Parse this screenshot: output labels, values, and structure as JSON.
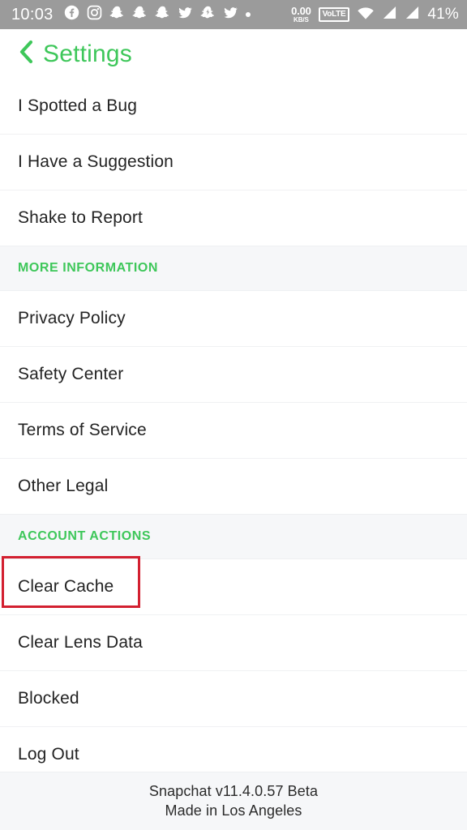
{
  "status_bar": {
    "time": "10:03",
    "background_color": "#9b9b9b",
    "left_icons": [
      "facebook-icon",
      "instagram-icon",
      "snapchat-icon",
      "snapchat-icon",
      "snapchat-icon",
      "twitter-icon",
      "snapchat-bolt-icon",
      "twitter-icon",
      "dot-indicator-icon"
    ],
    "data_rate_value": "0.00",
    "data_rate_unit": "KB/S",
    "volte_badge": "VoLTE",
    "right_icons": [
      "wifi-icon",
      "signal-icon",
      "signal-icon"
    ],
    "battery": "41%"
  },
  "header": {
    "back_icon": "chevron-left-icon",
    "title": "Settings",
    "accent_color": "#3ec75a"
  },
  "list": {
    "items": [
      {
        "type": "row",
        "label": "I Spotted a Bug"
      },
      {
        "type": "row",
        "label": "I Have a Suggestion"
      },
      {
        "type": "row",
        "label": "Shake to Report"
      },
      {
        "type": "section",
        "label": "MORE INFORMATION"
      },
      {
        "type": "row",
        "label": "Privacy Policy"
      },
      {
        "type": "row",
        "label": "Safety Center"
      },
      {
        "type": "row",
        "label": "Terms of Service"
      },
      {
        "type": "row",
        "label": "Other Legal"
      },
      {
        "type": "section",
        "label": "ACCOUNT ACTIONS"
      },
      {
        "type": "row",
        "label": "Clear Cache",
        "highlighted": true
      },
      {
        "type": "row",
        "label": "Clear Lens Data"
      },
      {
        "type": "row",
        "label": "Blocked"
      },
      {
        "type": "row",
        "label": "Log Out"
      }
    ]
  },
  "highlight": {
    "target": "Clear Cache",
    "color": "#d32030"
  },
  "footer": {
    "line1": "Snapchat v11.4.0.57 Beta",
    "line2": "Made in Los Angeles"
  }
}
